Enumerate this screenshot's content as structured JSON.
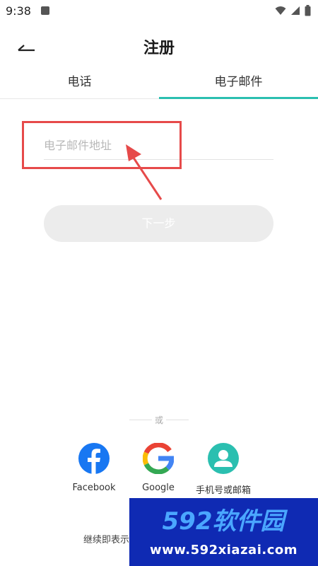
{
  "status_bar": {
    "time": "9:38",
    "icons": [
      "a-icon",
      "wifi-icon",
      "signal-icon",
      "battery-icon"
    ]
  },
  "header": {
    "title": "注册",
    "back_icon": "back-arrow-icon"
  },
  "tabs": [
    {
      "label": "电话",
      "active": false
    },
    {
      "label": "电子邮件",
      "active": true
    }
  ],
  "form": {
    "email_placeholder": "电子邮件地址",
    "email_value": "",
    "next_label": "下一步"
  },
  "divider": {
    "label": "或"
  },
  "social": [
    {
      "label": "Facebook",
      "icon": "facebook-icon"
    },
    {
      "label": "Google",
      "icon": "google-icon"
    },
    {
      "label": "手机号或邮箱",
      "icon": "person-icon"
    }
  ],
  "terms": {
    "text": "继续即表示"
  },
  "watermark": {
    "brand": "592软件园",
    "url": "www.592xiazai.com"
  },
  "colors": {
    "accent": "#2bbfb0",
    "highlight": "#e64a4a",
    "facebook": "#1877f2",
    "person": "#2bbfb0",
    "watermark_bg": "#0f2ab3"
  }
}
